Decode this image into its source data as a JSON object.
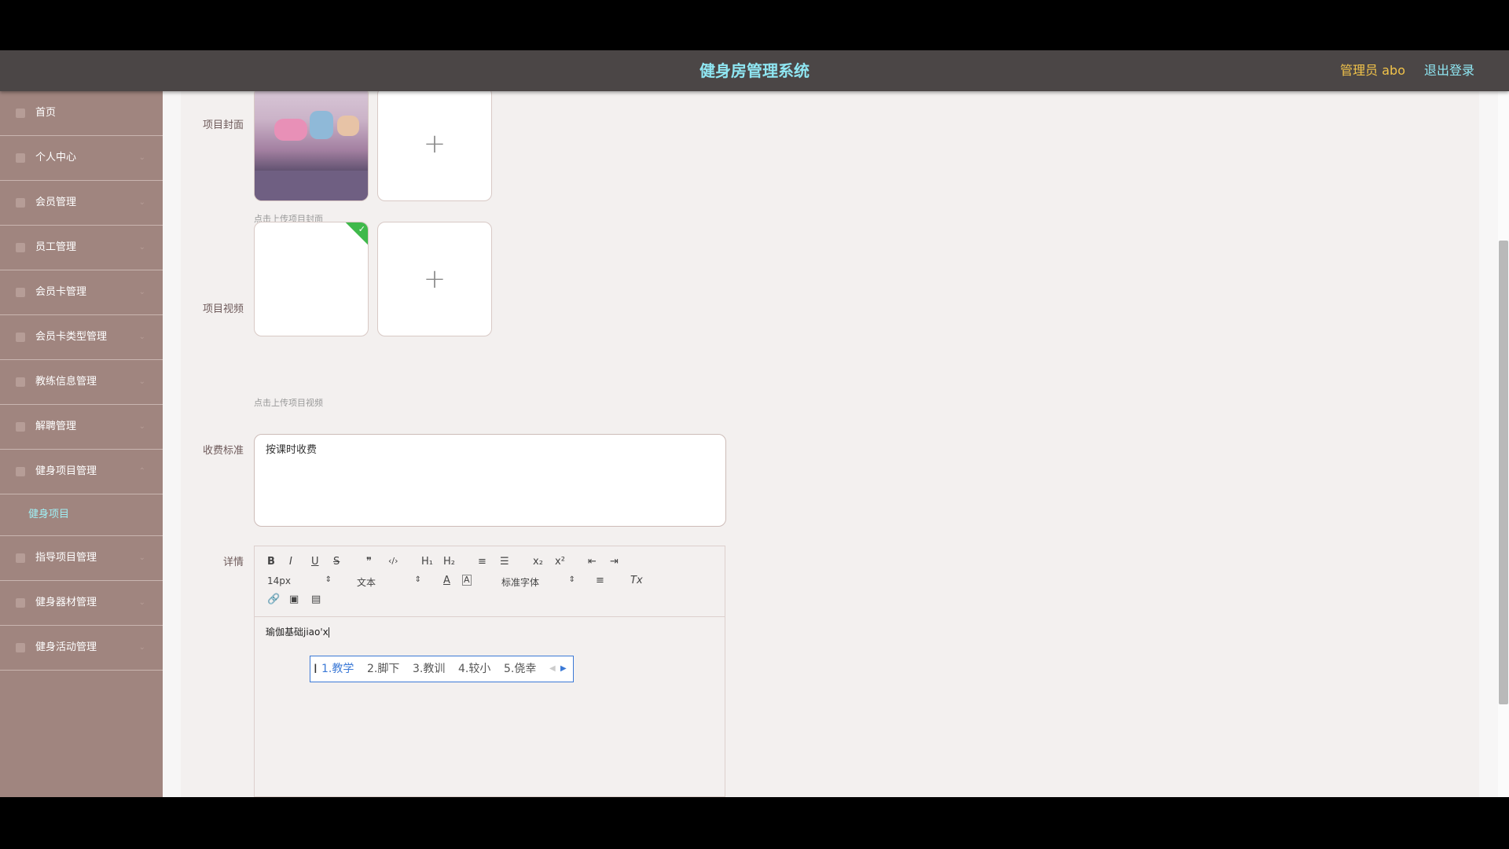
{
  "header": {
    "title": "健身房管理系统",
    "user": "管理员 abo",
    "logout": "退出登录"
  },
  "sidebar": {
    "items": [
      {
        "label": "首页"
      },
      {
        "label": "个人中心"
      },
      {
        "label": "会员管理"
      },
      {
        "label": "员工管理"
      },
      {
        "label": "会员卡管理"
      },
      {
        "label": "会员卡类型管理"
      },
      {
        "label": "教练信息管理"
      },
      {
        "label": "解聘管理"
      },
      {
        "label": "健身项目管理"
      },
      {
        "label": "指导项目管理"
      },
      {
        "label": "健身器材管理"
      },
      {
        "label": "健身活动管理"
      }
    ],
    "active_sub": "健身项目"
  },
  "form": {
    "cover_label": "项目封面",
    "cover_hint": "点击上传项目封面",
    "video_label": "项目视频",
    "video_hint": "点击上传项目视频",
    "fee_label": "收费标准",
    "fee_value": "按课时收费",
    "detail_label": "详情"
  },
  "editor": {
    "toolbar_row1": [
      "B",
      "I",
      "U",
      "S",
      "❞",
      "‹/›",
      "H₁",
      "H₂",
      "≡",
      "☰",
      "x₂",
      "x²",
      "⇤",
      "⇥"
    ],
    "font_size": "14px",
    "text_type": "文本",
    "font_family": "标准字体",
    "clear_format": "Tx",
    "content": "瑜伽基础jiao'x"
  },
  "ime": {
    "candidates": [
      "1.教学",
      "2.脚下",
      "3.教训",
      "4.较小",
      "5.侥幸"
    ]
  }
}
